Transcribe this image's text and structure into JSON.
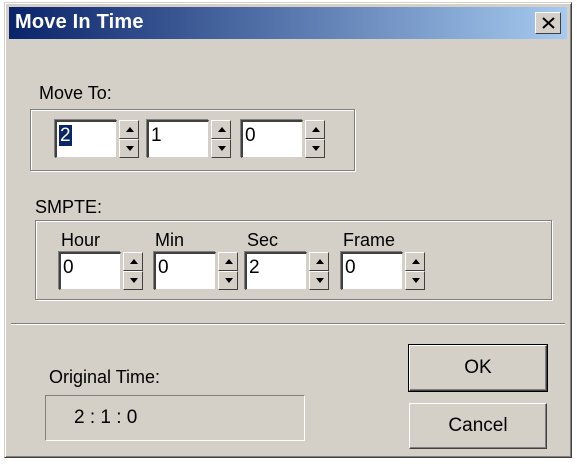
{
  "window": {
    "title": "Move In Time"
  },
  "move_to": {
    "label": "Move To:",
    "fields": [
      "2",
      "1",
      "0"
    ]
  },
  "smpte": {
    "label": "SMPTE:",
    "columns": [
      "Hour",
      "Min",
      "Sec",
      "Frame"
    ],
    "values": [
      "0",
      "0",
      "2",
      "0"
    ]
  },
  "original_time": {
    "label": "Original Time:",
    "value": "2 : 1 : 0"
  },
  "buttons": {
    "ok": "OK",
    "cancel": "Cancel"
  },
  "colors": {
    "title_start": "#0a246a",
    "title_end": "#a6caf0",
    "face": "#d4d0c8"
  }
}
